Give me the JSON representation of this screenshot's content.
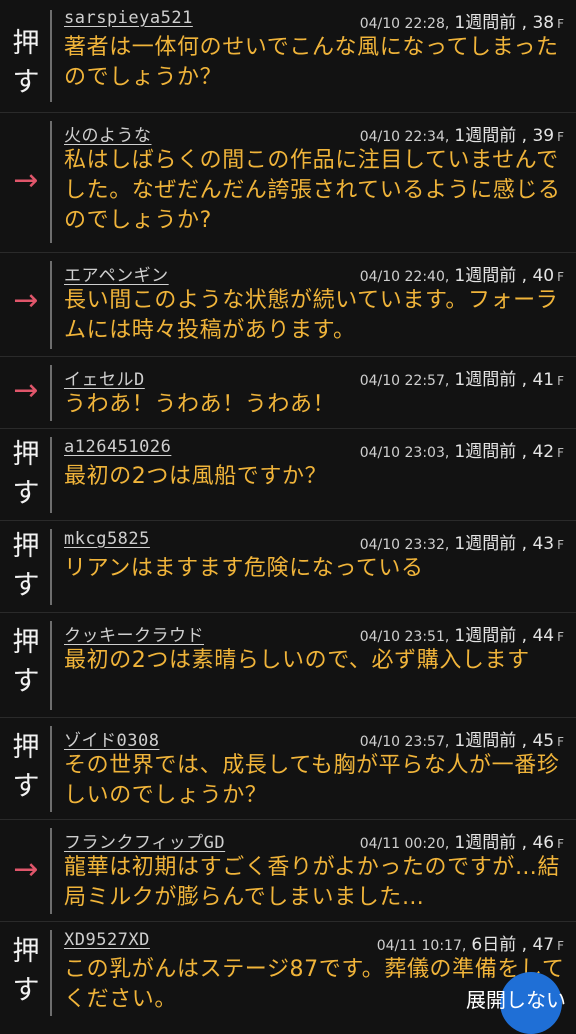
{
  "comments": [
    {
      "type": "push",
      "mark": "押\nす",
      "user": "sarspieya521",
      "time": "04/10 22:28,",
      "ago": "1週間前",
      "floor": "38",
      "floor_unit": "F",
      "text": "著者は一体何のせいでこんな風になってしまったのでしょうか？"
    },
    {
      "type": "arrow",
      "mark": "→",
      "user": "火のような",
      "time": "04/10 22:34,",
      "ago": "1週間前",
      "floor": "39",
      "floor_unit": "F",
      "text": "私はしばらくの間この作品に注目していませんでした。なぜだんだん誇張されているように感じるのでしょうか?"
    },
    {
      "type": "arrow",
      "mark": "→",
      "user": "エアペンギン",
      "time": "04/10 22:40,",
      "ago": "1週間前",
      "floor": "40",
      "floor_unit": "F",
      "text": "長い間このような状態が続いています。フォーラムには時々投稿があります。"
    },
    {
      "type": "arrow",
      "mark": "→",
      "user": "イェセルD",
      "time": "04/10 22:57,",
      "ago": "1週間前",
      "floor": "41",
      "floor_unit": "F",
      "text": "うわあ！うわあ！うわあ！"
    },
    {
      "type": "push",
      "mark": "押\nす",
      "user": "a126451026",
      "time": "04/10 23:03,",
      "ago": "1週間前",
      "floor": "42",
      "floor_unit": "F",
      "text": "最初の2つは風船ですか？"
    },
    {
      "type": "push",
      "mark": "押\nす",
      "user": "mkcg5825",
      "time": "04/10 23:32,",
      "ago": "1週間前",
      "floor": "43",
      "floor_unit": "F",
      "text": "リアンはますます危険になっている"
    },
    {
      "type": "push",
      "mark": "押\nす",
      "user": "クッキークラウド",
      "time": "04/10 23:51,",
      "ago": "1週間前",
      "floor": "44",
      "floor_unit": "F",
      "text": "最初の2つは素晴らしいので、必ず購入します"
    },
    {
      "type": "push",
      "mark": "押\nす",
      "user": "ゾイド0308",
      "time": "04/10 23:57,",
      "ago": "1週間前",
      "floor": "45",
      "floor_unit": "F",
      "text": "その世界では、成長しても胸が平らな人が一番珍しいのでしょうか？"
    },
    {
      "type": "arrow",
      "mark": "→",
      "user": "フランクフィップGD",
      "time": "04/11 00:20,",
      "ago": "1週間前",
      "floor": "46",
      "floor_unit": "F",
      "text": "龍華は初期はすごく香りがよかったのですが…結局ミルクが膨らんでしまいました…"
    },
    {
      "type": "push",
      "mark": "押\nす",
      "user": "XD9527XD",
      "time": "04/11 10:17,",
      "ago": "6日前",
      "floor": "47",
      "floor_unit": "F",
      "text": "この乳がんはステージ87です。葬儀の準備をしてください。"
    }
  ],
  "expand_label": "展開しない",
  "fab_icon": "expand-icon"
}
